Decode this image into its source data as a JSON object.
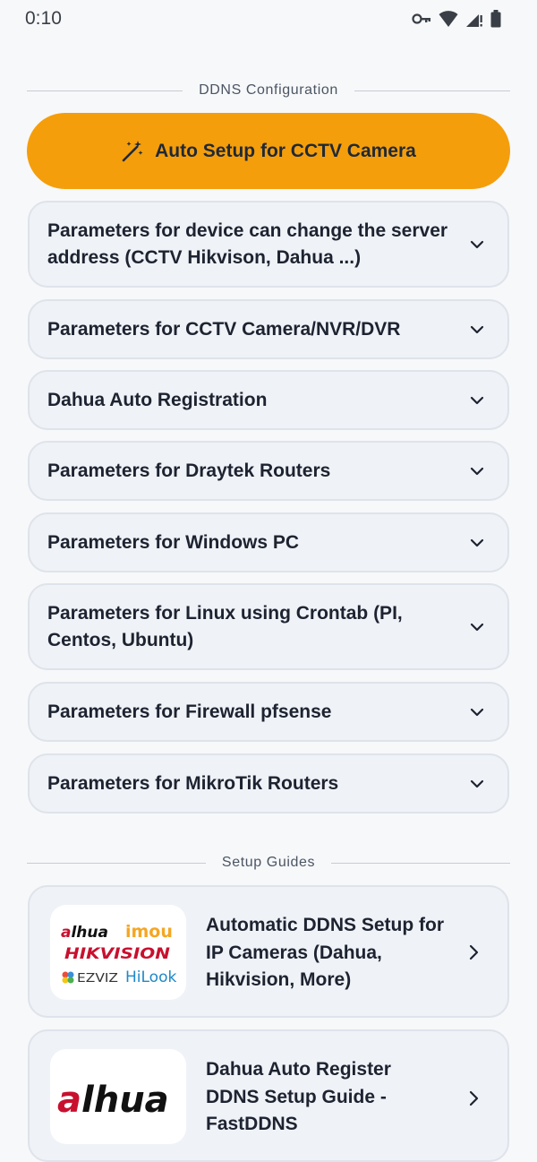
{
  "status": {
    "time": "0:10"
  },
  "config": {
    "section_title": "DDNS Configuration",
    "auto_setup_label": "Auto Setup for CCTV Camera",
    "items": [
      "Parameters for device can change the server address (CCTV Hikvison, Dahua ...)",
      "Parameters for CCTV Camera/NVR/DVR",
      "Dahua Auto Registration",
      "Parameters for Draytek Routers",
      "Parameters for Windows PC",
      "Parameters for Linux using Crontab (PI, Centos, Ubuntu)",
      "Parameters for Firewall pfsense",
      "Parameters for MikroTik Routers"
    ]
  },
  "guides": {
    "section_title": "Setup Guides",
    "items": [
      {
        "title": "Automatic DDNS Setup for IP Cameras (Dahua, Hikvision, More)",
        "logos": [
          "alhua",
          "imou",
          "HIKVISION",
          "EZVIZ",
          "HiLook"
        ]
      },
      {
        "title": "Dahua Auto Register DDNS Setup Guide - FastDDNS",
        "logos": [
          "alhua"
        ]
      }
    ]
  },
  "colors": {
    "accent": "#f59e0b",
    "card_bg": "#eff2f7",
    "card_border": "#dfe3ea"
  }
}
